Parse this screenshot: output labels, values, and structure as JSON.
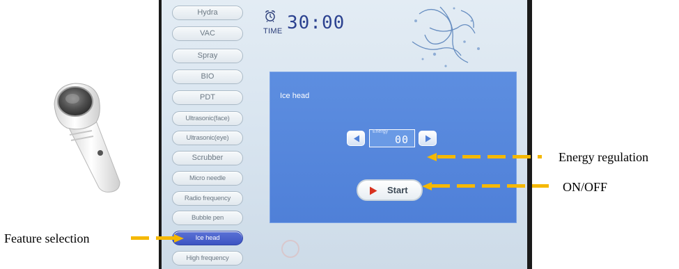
{
  "colors": {
    "accent_yellow": "#f5b800",
    "panel_blue": "#5287dc",
    "active_blue": "#4a60cc"
  },
  "sidebar": {
    "items": [
      {
        "label": "Hydra",
        "active": false
      },
      {
        "label": "VAC",
        "active": false
      },
      {
        "label": "Spray",
        "active": false
      },
      {
        "label": "BIO",
        "active": false
      },
      {
        "label": "PDT",
        "active": false
      },
      {
        "label": "Ultrasonic(face)",
        "active": false
      },
      {
        "label": "Ultrasonic(eye)",
        "active": false
      },
      {
        "label": "Scrubber",
        "active": false
      },
      {
        "label": "Micro needle",
        "active": false
      },
      {
        "label": "Radio frequency",
        "active": false
      },
      {
        "label": "Bubble pen",
        "active": false
      },
      {
        "label": "Ice head",
        "active": true
      },
      {
        "label": "High frequency",
        "active": false
      }
    ]
  },
  "timer": {
    "icon": "alarm-clock-icon",
    "label": "TIME",
    "value": "30:00"
  },
  "panel": {
    "title": "Ice head",
    "energy": {
      "label": "Energy",
      "value": "00",
      "decrease_icon": "triangle-left-icon",
      "increase_icon": "triangle-right-icon"
    },
    "start": {
      "icon": "play-icon",
      "label": "Start"
    }
  },
  "annotations": {
    "energy_regulation": "Energy regulation",
    "on_off": "ON/OFF",
    "feature_selection": "Feature selection"
  }
}
